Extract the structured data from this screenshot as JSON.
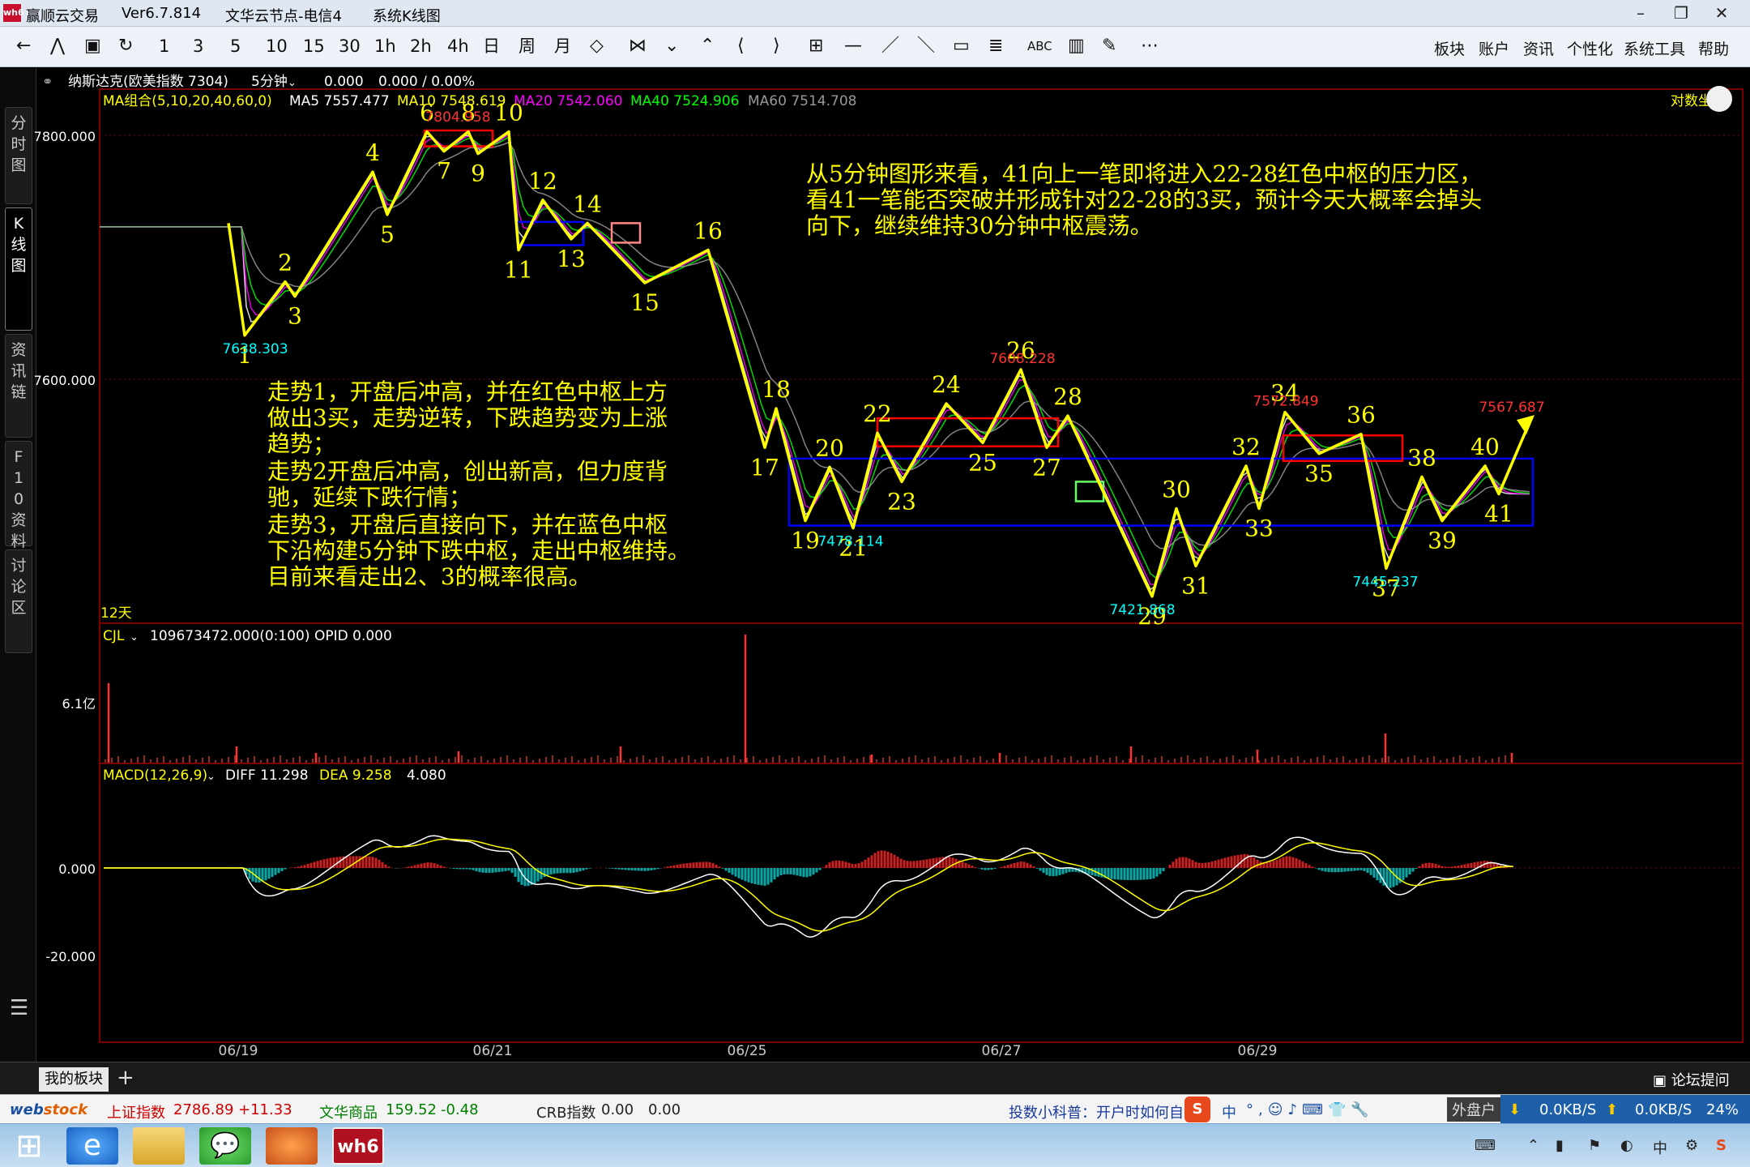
{
  "window": {
    "title_app": "赢顺云交易",
    "version": "Ver6.7.814",
    "node": "文华云节点-电信4",
    "system": "系统K线图"
  },
  "toolbar": {
    "buttons": [
      "←",
      "⋀",
      "▣",
      "↻",
      "1",
      "3",
      "5",
      "10",
      "15",
      "30",
      "1h",
      "2h",
      "4h",
      "日",
      "周",
      "月",
      "◇",
      "⋈",
      "⌄",
      "⌃",
      "⟨",
      "⟩",
      "⊞",
      "—",
      "／",
      "＼",
      "▭",
      "≣",
      "ABC",
      "▥",
      "✎",
      "⋯"
    ],
    "menus": [
      "板块",
      "账户",
      "资讯",
      "个性化",
      "系统工具",
      "帮助"
    ]
  },
  "left_tabs": [
    {
      "label": "分时图"
    },
    {
      "label": "K线图"
    },
    {
      "label": "资讯链"
    },
    {
      "label": "F10资料"
    },
    {
      "label": "讨论区"
    }
  ],
  "instrument": {
    "name": "纳斯达克(欧美指数 7304)",
    "period": "5分钟",
    "price": "0.000",
    "change": "0.000 / 0.00%"
  },
  "ma_legend": {
    "group": "MA组合(5,10,20,40,60,0)",
    "ma5": "MA5 7557.477",
    "ma10": "MA10 7548.619",
    "ma20": "MA20 7542.060",
    "ma40": "MA40 7524.906",
    "ma60": "MA60 7514.708",
    "log_label": "对数坐"
  },
  "colors": {
    "ma5": "#ffffff",
    "ma10": "#ffff00",
    "ma20": "#ff00ff",
    "ma40": "#00ff00",
    "ma60": "#999999",
    "pen": "#ffff00",
    "zs_red": "#ff0000",
    "zs_blue": "#0000ff",
    "macd_pos": "#cc2222",
    "macd_neg": "#00aaaa"
  },
  "price_axis": {
    "labels": [
      "7800.000",
      "7600.000"
    ]
  },
  "period_span": "12天",
  "volume": {
    "title": "CJL",
    "value": "109673472.000(0:100)",
    "opid": "OPID 0.000",
    "axis_label": "6.1亿"
  },
  "macd": {
    "title": "MACD(12,26,9)",
    "diff": "DIFF 11.298",
    "dea": "DEA 9.258",
    "macd": "4.080",
    "axis": [
      "0.000",
      "-20.000"
    ]
  },
  "dates": [
    "06/19",
    "06/21",
    "06/25",
    "06/27",
    "06/29"
  ],
  "price_annotations": [
    {
      "text": "7638.303",
      "color": "#00ffff",
      "price": 7636
    },
    {
      "text": "7804.958",
      "color": "#ff3333",
      "price": 7806
    },
    {
      "text": "7608.228",
      "color": "#ff3333",
      "price": 7608
    },
    {
      "text": "7478.114",
      "color": "#00ffff",
      "price": 7478
    },
    {
      "text": "7421.868",
      "color": "#00ffff",
      "price": 7422
    },
    {
      "text": "7572.849",
      "color": "#ff3333",
      "price": 7573
    },
    {
      "text": "7445.237",
      "color": "#00ffff",
      "price": 7445
    },
    {
      "text": "7567.687",
      "color": "#ff3333",
      "price": 7568
    }
  ],
  "pen_points": [
    {
      "n": "1",
      "price": 7636
    },
    {
      "n": "2",
      "price": 7680
    },
    {
      "n": "3",
      "price": 7668
    },
    {
      "n": "4",
      "price": 7770
    },
    {
      "n": "5",
      "price": 7735
    },
    {
      "n": "6",
      "price": 7803
    },
    {
      "n": "7",
      "price": 7787
    },
    {
      "n": "8",
      "price": 7803
    },
    {
      "n": "9",
      "price": 7785
    },
    {
      "n": "10",
      "price": 7803
    },
    {
      "n": "11",
      "price": 7706
    },
    {
      "n": "12",
      "price": 7747
    },
    {
      "n": "13",
      "price": 7715
    },
    {
      "n": "14",
      "price": 7728
    },
    {
      "n": "15",
      "price": 7679
    },
    {
      "n": "16",
      "price": 7706
    },
    {
      "n": "17",
      "price": 7544
    },
    {
      "n": "18",
      "price": 7576
    },
    {
      "n": "19",
      "price": 7484
    },
    {
      "n": "20",
      "price": 7528
    },
    {
      "n": "21",
      "price": 7478
    },
    {
      "n": "22",
      "price": 7556
    },
    {
      "n": "23",
      "price": 7516
    },
    {
      "n": "24",
      "price": 7580
    },
    {
      "n": "25",
      "price": 7548
    },
    {
      "n": "26",
      "price": 7608
    },
    {
      "n": "27",
      "price": 7544
    },
    {
      "n": "28",
      "price": 7570
    },
    {
      "n": "29",
      "price": 7422
    },
    {
      "n": "30",
      "price": 7494
    },
    {
      "n": "31",
      "price": 7447
    },
    {
      "n": "32",
      "price": 7529
    },
    {
      "n": "33",
      "price": 7494
    },
    {
      "n": "34",
      "price": 7573
    },
    {
      "n": "35",
      "price": 7539
    },
    {
      "n": "36",
      "price": 7555
    },
    {
      "n": "37",
      "price": 7445
    },
    {
      "n": "38",
      "price": 7520
    },
    {
      "n": "39",
      "price": 7484
    },
    {
      "n": "40",
      "price": 7529
    },
    {
      "n": "41",
      "price": 7506
    }
  ],
  "zhongshu": [
    {
      "color": "red",
      "high": 7804,
      "low": 7791
    },
    {
      "color": "blue",
      "high": 7729,
      "low": 7710
    },
    {
      "color": "pink",
      "high": 7728,
      "low": 7712
    },
    {
      "color": "red",
      "high": 7568,
      "low": 7545
    },
    {
      "color": "blue",
      "high": 7535,
      "low": 7480
    },
    {
      "color": "green",
      "high": 7516,
      "low": 7500
    },
    {
      "color": "red",
      "high": 7554,
      "low": 7533
    }
  ],
  "text_box_1": [
    "从5分钟图形来看，41向上一笔即将进入22-28红色中枢的压力区，",
    "看41一笔能否突破并形成针对22-28的3买，预计今天大概率会掉头",
    "向下，继续维持30分钟中枢震荡。"
  ],
  "text_box_2": [
    "走势1，开盘后冲高，并在红色中枢上方",
    "做出3买，走势逆转，下跌趋势变为上涨",
    "趋势；",
    "走势2开盘后冲高，创出新高，但力度背",
    "驰，延续下跌行情；",
    "走势3，开盘后直接向下，并在蓝色中枢",
    "下沿构建5分钟下跌中枢，走出中枢维持。",
    "目前来看走出2、3的概率很高。"
  ],
  "bottom": {
    "panel": "我的板块",
    "add": "+",
    "forum": "论坛提问"
  },
  "ticker": {
    "logo_web": "web",
    "logo_stock": "stock",
    "sh_label": "上证指数",
    "sh_value": "2786.89",
    "sh_change": "+11.33",
    "wh_label": "文华商品",
    "wh_value": "159.52",
    "wh_change": "-0.48",
    "crb_label": "CRB指数",
    "crb_value": "0.00",
    "crb_change": "0.00",
    "tip": "投数小科普：开户时如何自",
    "ime": "中",
    "outer": "外盘户",
    "down": "0.0KB/S",
    "up": "0.0KB/S",
    "pct": "24%"
  },
  "taskbar": {
    "clock": "中"
  }
}
